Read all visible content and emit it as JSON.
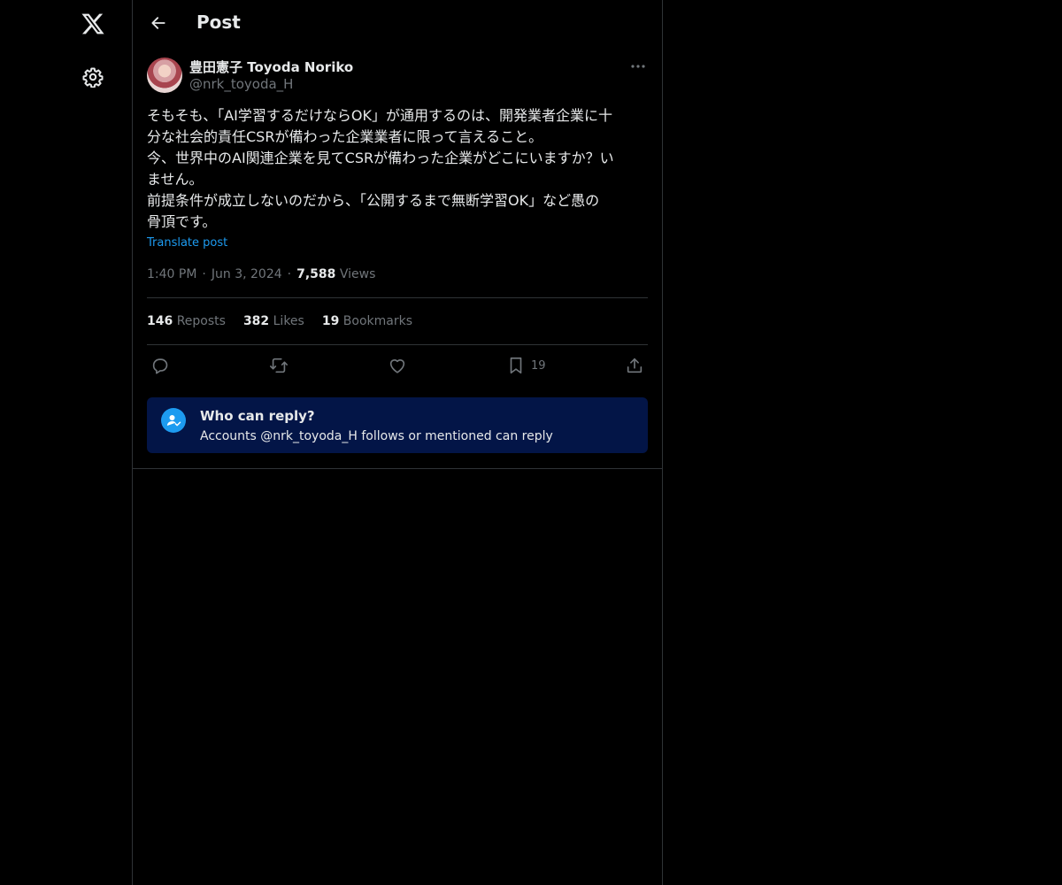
{
  "nav": {
    "logo_icon": "x-logo-icon",
    "settings_icon": "gear-icon"
  },
  "header": {
    "title": "Post",
    "back_icon": "arrow-left-icon"
  },
  "post": {
    "author_name": "豊田憲子 Toyoda Noriko",
    "author_handle": "@nrk_toyoda_H",
    "text_lines": [
      "そもそも、「AI学習するだけならOK」が通用するのは、開発業者企業に十",
      "分な社会的責任CSRが備わった企業業者に限って言えること。",
      "今、世界中のAI関連企業を見てCSRが備わった企業がどこにいますか？い",
      "ません。",
      "前提条件が成立しないのだから、「公開するまで無断学習OK」など愚の",
      "骨頂です。"
    ],
    "translate_label": "Translate post",
    "time": "1:40 PM",
    "date": "Jun 3, 2024",
    "separator": "·",
    "views_count": "7,588",
    "views_label": "Views",
    "stats": {
      "reposts_count": "146",
      "reposts_label": "Reposts",
      "likes_count": "382",
      "likes_label": "Likes",
      "bookmarks_count": "19",
      "bookmarks_label": "Bookmarks"
    },
    "actions": {
      "bookmark_count": "19"
    }
  },
  "reply_restriction": {
    "title": "Who can reply?",
    "description": "Accounts @nrk_toyoda_H follows or mentioned can reply",
    "icon": "person-check-icon"
  },
  "colors": {
    "background": "#000000",
    "text": "#e7e9ea",
    "muted": "#71767b",
    "accent": "#1d9bf0",
    "reply_box": "#031547",
    "border": "#2f3336"
  }
}
